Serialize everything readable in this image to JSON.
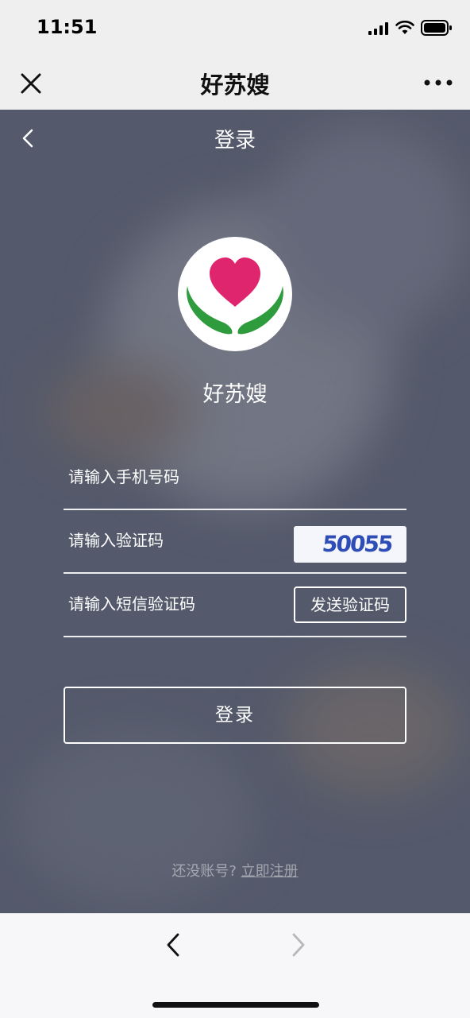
{
  "status_bar": {
    "time": "11:51"
  },
  "title_bar": {
    "title": "好苏嫂"
  },
  "page": {
    "header_title": "登录",
    "app_name": "好苏嫂",
    "form": {
      "phone_placeholder": "请输入手机号码",
      "captcha_placeholder": "请输入验证码",
      "captcha_text": "50055",
      "sms_code_placeholder": "请输入短信验证码",
      "send_code_label": "发送验证码"
    },
    "login_button": "登录",
    "register_prompt": "还没账号?",
    "register_link": "立即注册"
  },
  "colors": {
    "overlay": "#5d6273",
    "heart": "#e0256f",
    "hands": "#2e9c3d",
    "captcha_text": "#2f4db7"
  },
  "icons": [
    "close-icon",
    "more-icon",
    "back-icon",
    "chevron-left-icon",
    "chevron-right-icon",
    "signal-icon",
    "wifi-icon",
    "battery-icon"
  ]
}
